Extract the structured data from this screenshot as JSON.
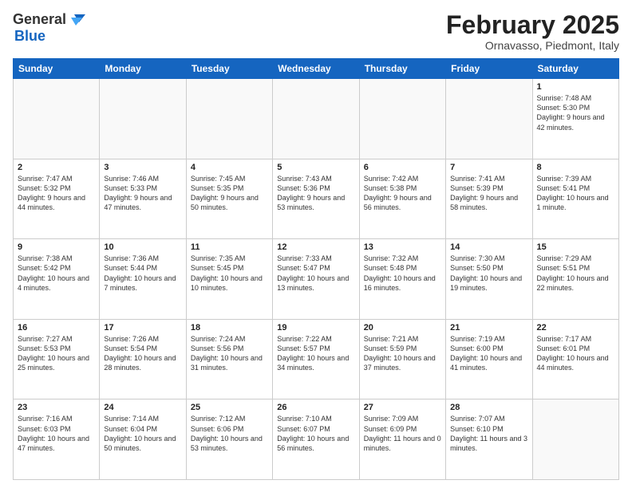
{
  "header": {
    "logo_general": "General",
    "logo_blue": "Blue",
    "month_title": "February 2025",
    "location": "Ornavasso, Piedmont, Italy"
  },
  "weekdays": [
    "Sunday",
    "Monday",
    "Tuesday",
    "Wednesday",
    "Thursday",
    "Friday",
    "Saturday"
  ],
  "weeks": [
    [
      {
        "day": "",
        "info": ""
      },
      {
        "day": "",
        "info": ""
      },
      {
        "day": "",
        "info": ""
      },
      {
        "day": "",
        "info": ""
      },
      {
        "day": "",
        "info": ""
      },
      {
        "day": "",
        "info": ""
      },
      {
        "day": "1",
        "info": "Sunrise: 7:48 AM\nSunset: 5:30 PM\nDaylight: 9 hours and 42 minutes."
      }
    ],
    [
      {
        "day": "2",
        "info": "Sunrise: 7:47 AM\nSunset: 5:32 PM\nDaylight: 9 hours and 44 minutes."
      },
      {
        "day": "3",
        "info": "Sunrise: 7:46 AM\nSunset: 5:33 PM\nDaylight: 9 hours and 47 minutes."
      },
      {
        "day": "4",
        "info": "Sunrise: 7:45 AM\nSunset: 5:35 PM\nDaylight: 9 hours and 50 minutes."
      },
      {
        "day": "5",
        "info": "Sunrise: 7:43 AM\nSunset: 5:36 PM\nDaylight: 9 hours and 53 minutes."
      },
      {
        "day": "6",
        "info": "Sunrise: 7:42 AM\nSunset: 5:38 PM\nDaylight: 9 hours and 56 minutes."
      },
      {
        "day": "7",
        "info": "Sunrise: 7:41 AM\nSunset: 5:39 PM\nDaylight: 9 hours and 58 minutes."
      },
      {
        "day": "8",
        "info": "Sunrise: 7:39 AM\nSunset: 5:41 PM\nDaylight: 10 hours and 1 minute."
      }
    ],
    [
      {
        "day": "9",
        "info": "Sunrise: 7:38 AM\nSunset: 5:42 PM\nDaylight: 10 hours and 4 minutes."
      },
      {
        "day": "10",
        "info": "Sunrise: 7:36 AM\nSunset: 5:44 PM\nDaylight: 10 hours and 7 minutes."
      },
      {
        "day": "11",
        "info": "Sunrise: 7:35 AM\nSunset: 5:45 PM\nDaylight: 10 hours and 10 minutes."
      },
      {
        "day": "12",
        "info": "Sunrise: 7:33 AM\nSunset: 5:47 PM\nDaylight: 10 hours and 13 minutes."
      },
      {
        "day": "13",
        "info": "Sunrise: 7:32 AM\nSunset: 5:48 PM\nDaylight: 10 hours and 16 minutes."
      },
      {
        "day": "14",
        "info": "Sunrise: 7:30 AM\nSunset: 5:50 PM\nDaylight: 10 hours and 19 minutes."
      },
      {
        "day": "15",
        "info": "Sunrise: 7:29 AM\nSunset: 5:51 PM\nDaylight: 10 hours and 22 minutes."
      }
    ],
    [
      {
        "day": "16",
        "info": "Sunrise: 7:27 AM\nSunset: 5:53 PM\nDaylight: 10 hours and 25 minutes."
      },
      {
        "day": "17",
        "info": "Sunrise: 7:26 AM\nSunset: 5:54 PM\nDaylight: 10 hours and 28 minutes."
      },
      {
        "day": "18",
        "info": "Sunrise: 7:24 AM\nSunset: 5:56 PM\nDaylight: 10 hours and 31 minutes."
      },
      {
        "day": "19",
        "info": "Sunrise: 7:22 AM\nSunset: 5:57 PM\nDaylight: 10 hours and 34 minutes."
      },
      {
        "day": "20",
        "info": "Sunrise: 7:21 AM\nSunset: 5:59 PM\nDaylight: 10 hours and 37 minutes."
      },
      {
        "day": "21",
        "info": "Sunrise: 7:19 AM\nSunset: 6:00 PM\nDaylight: 10 hours and 41 minutes."
      },
      {
        "day": "22",
        "info": "Sunrise: 7:17 AM\nSunset: 6:01 PM\nDaylight: 10 hours and 44 minutes."
      }
    ],
    [
      {
        "day": "23",
        "info": "Sunrise: 7:16 AM\nSunset: 6:03 PM\nDaylight: 10 hours and 47 minutes."
      },
      {
        "day": "24",
        "info": "Sunrise: 7:14 AM\nSunset: 6:04 PM\nDaylight: 10 hours and 50 minutes."
      },
      {
        "day": "25",
        "info": "Sunrise: 7:12 AM\nSunset: 6:06 PM\nDaylight: 10 hours and 53 minutes."
      },
      {
        "day": "26",
        "info": "Sunrise: 7:10 AM\nSunset: 6:07 PM\nDaylight: 10 hours and 56 minutes."
      },
      {
        "day": "27",
        "info": "Sunrise: 7:09 AM\nSunset: 6:09 PM\nDaylight: 11 hours and 0 minutes."
      },
      {
        "day": "28",
        "info": "Sunrise: 7:07 AM\nSunset: 6:10 PM\nDaylight: 11 hours and 3 minutes."
      },
      {
        "day": "",
        "info": ""
      }
    ]
  ]
}
